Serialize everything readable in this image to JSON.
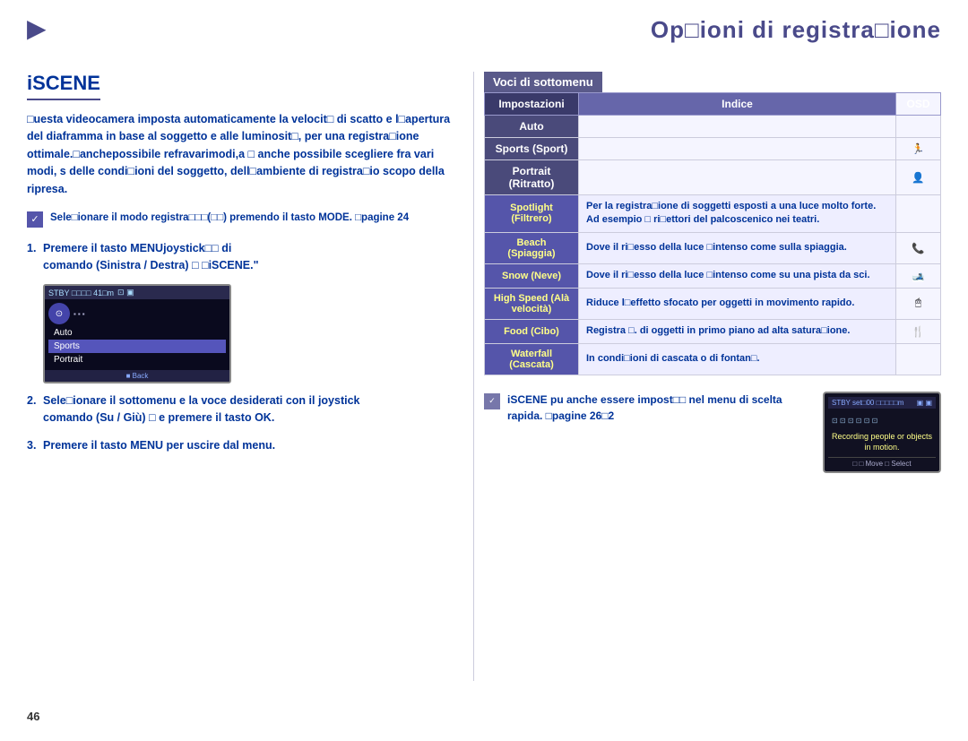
{
  "header": {
    "icon": "▶",
    "title": "Op□ioni di registra□ione"
  },
  "left": {
    "section_title": "iSCENE",
    "intro": "□uesta videocamera imposta automaticamente la velocit□ di scatto e l□apertura del diaframma in base al soggetto e alle luminosit□, per una registra□ione ottimale.□anchepossibile refravarimodi,a □ anche possibile scegliere fra vari modi, s delle condi□ioni del soggetto, dell□ambiente di registra□io scopo della ripresa.",
    "note": {
      "icon": "✓",
      "text": "Sele□ionare il modo registra□□□(□□) premendo il tasto MODE. □pagine 24"
    },
    "steps": [
      {
        "num": "1.",
        "text": "Premere il tasto MENUjoystick□□ di",
        "sub": "comando (Sinistra / Destra) □ □iSCENE.\""
      },
      {
        "num": "2.",
        "text": "Sele□ionare il sottomenu e la voce desiderati con il joystick",
        "sub": "comando (Su / Giù) □ e premere il tasto OK."
      },
      {
        "num": "3.",
        "text": "Premere il tasto MENU per uscire dal menu."
      }
    ],
    "mini_screen": {
      "header": "STBY □□□□ 41□m",
      "items": [
        "Auto",
        "Sports",
        "Portrait"
      ]
    }
  },
  "right": {
    "voci_label": "Voci di sottomenu",
    "table": {
      "headers": [
        "Impostazioni",
        "Indice",
        "OSD"
      ],
      "rows": [
        {
          "impostazioni": "Auto",
          "indice": "",
          "osd": "",
          "highlighted": false
        },
        {
          "impostazioni": "Sports (Sport)",
          "indice": "",
          "osd": "🏃",
          "highlighted": false
        },
        {
          "impostazioni": "Portrait (Ritratto)",
          "indice": "",
          "osd": "👤",
          "highlighted": false
        },
        {
          "impostazioni": "Spotlight (Filtrero)",
          "indice": "Per la registra□ione di soggetti esposti a una luce molto forte. Ad esempio □ ri□ettori del palcoscenico nei teatri.",
          "osd": "",
          "highlighted": true
        },
        {
          "impostazioni": "Beach (Spiaggia)",
          "indice": "Dove il ri□esso della luce □intenso come sulla spiaggia.",
          "osd": "📞",
          "highlighted": true
        },
        {
          "impostazioni": "Snow (Neve)",
          "indice": "Dove il ri□esso della luce □intenso come su una pista da sci.",
          "osd": "🎿",
          "highlighted": true
        },
        {
          "impostazioni": "High Speed (Alà velocità)",
          "indice": "Riduce l□effetto sfocato per oggetti in movimento rapido.",
          "osd": "🖱",
          "highlighted": true
        },
        {
          "impostazioni": "Food (Cibo)",
          "indice": "Registra □. di oggetti in primo piano ad alta satura□ione.",
          "osd": "🍴",
          "highlighted": true
        },
        {
          "impostazioni": "Waterfall (Cascata)",
          "indice": "In condi□ioni di cascata o di fontan□.",
          "osd": "",
          "highlighted": true
        }
      ]
    },
    "bottom_note": {
      "icon": "✓",
      "text": "iSCENE pu anche essere impost□□ nel menu di scelta rapida.\n□pagine 26□2"
    },
    "mini_camera": {
      "header_left": "STBY set□00 □□□□□m",
      "header_right": "",
      "message": "Recording people or objects in motion.",
      "footer": "□ □ Move    □ Select"
    }
  },
  "page_number": "46"
}
